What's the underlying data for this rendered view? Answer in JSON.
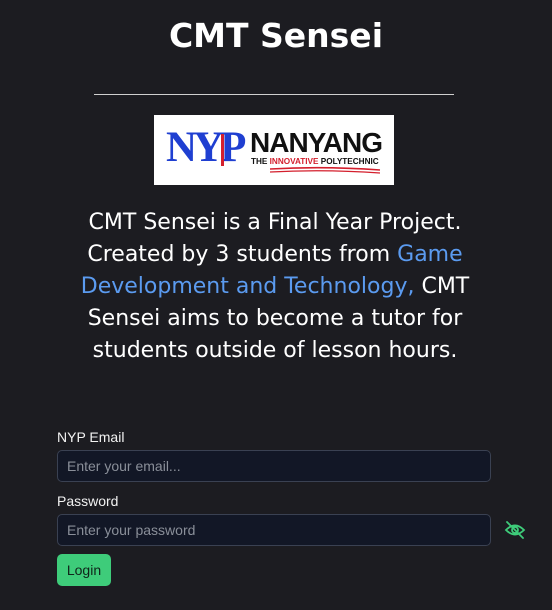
{
  "page": {
    "title": "CMT Sensei"
  },
  "logo": {
    "letters": "NYP",
    "name": "NANYANG",
    "tagline_prefix": "THE ",
    "tagline_accent": "INNOVATIVE",
    "tagline_suffix": " POLYTECHNIC"
  },
  "description": {
    "part1": "CMT Sensei is a Final Year Project. Created by 3 students from ",
    "link": "Game Development and Technology,",
    "part2": " CMT Sensei aims to become a tutor for students outside of lesson hours."
  },
  "form": {
    "email_label": "NYP Email",
    "email_placeholder": "Enter your email...",
    "email_value": "",
    "password_label": "Password",
    "password_placeholder": "Enter your password",
    "password_value": "",
    "toggle_icon": "eye-off-icon",
    "login_label": "Login"
  },
  "colors": {
    "background": "#1c1c21",
    "link": "#5b9bf0",
    "button": "#3ecc7a",
    "logo_blue": "#1f3fd1",
    "logo_red": "#d41f2d",
    "eye_icon": "#3ecc7a"
  }
}
